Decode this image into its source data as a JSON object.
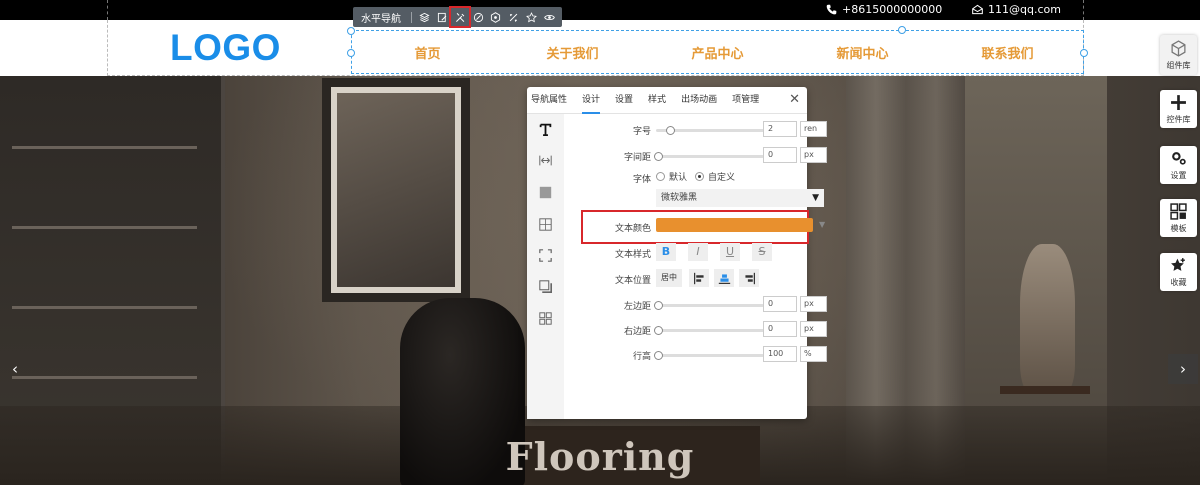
{
  "top_bar": {
    "phone": "+8615000000000",
    "email": "111@qq.com"
  },
  "component_toolbar": {
    "title": "水平导航",
    "buttons": [
      "layers-icon",
      "edit-page-icon",
      "tools-icon",
      "edit-style-icon",
      "settings-icon",
      "link-icon",
      "star-icon",
      "eye-icon"
    ]
  },
  "header": {
    "logo": "LOGO",
    "nav": [
      "首页",
      "关于我们",
      "产品中心",
      "新闻中心",
      "联系我们"
    ],
    "nav_color": "#e59a37",
    "logo_color": "#1a8de8"
  },
  "hero": {
    "title": "Flooring"
  },
  "right_tools": [
    {
      "label": "组件库",
      "icon": "cube-icon"
    },
    {
      "label": "控件库",
      "icon": "plus-icon"
    },
    {
      "label": "设置",
      "icon": "gear-icon"
    },
    {
      "label": "模板",
      "icon": "template-icon"
    },
    {
      "label": "收藏",
      "icon": "star-icon"
    }
  ],
  "panel": {
    "tabs": [
      "导航属性",
      "设计",
      "设置",
      "样式",
      "出场动画",
      "项管理"
    ],
    "active_tab": "设计",
    "fields": {
      "font_size_label": "字号",
      "font_size_value": "2",
      "font_size_unit": "ren",
      "letter_spacing_label": "字间距",
      "letter_spacing_value": "0",
      "letter_spacing_unit": "px",
      "font_label": "字体",
      "font_default": "默认",
      "font_custom": "自定义",
      "font_family_value": "微软雅黑",
      "text_color_label": "文本颜色",
      "text_color_value": "#e8902e",
      "text_style_label": "文本样式",
      "text_style_buttons": [
        "B",
        "I",
        "U",
        "S"
      ],
      "text_position_label": "文本位置",
      "text_position_center": "居中",
      "left_padding_label": "左边距",
      "left_padding_value": "0",
      "left_padding_unit": "px",
      "right_padding_label": "右边距",
      "right_padding_value": "0",
      "right_padding_unit": "px",
      "line_height_label": "行高",
      "line_height_value": "100",
      "line_height_unit": "%"
    }
  }
}
